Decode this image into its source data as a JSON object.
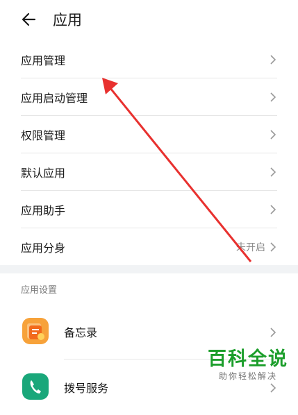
{
  "header": {
    "title": "应用"
  },
  "menu": {
    "items": [
      {
        "label": "应用管理"
      },
      {
        "label": "应用启动管理"
      },
      {
        "label": "权限管理"
      },
      {
        "label": "默认应用"
      },
      {
        "label": "应用助手"
      },
      {
        "label": "应用分身",
        "status": "未开启"
      }
    ]
  },
  "app_settings": {
    "section_title": "应用设置",
    "items": [
      {
        "label": "备忘录",
        "icon": "memo-icon"
      },
      {
        "label": "拨号服务",
        "icon": "phone-icon"
      }
    ]
  },
  "colors": {
    "arrow": "#e8312f",
    "memo": "#f7a23a",
    "phone": "#1aa77a"
  }
}
